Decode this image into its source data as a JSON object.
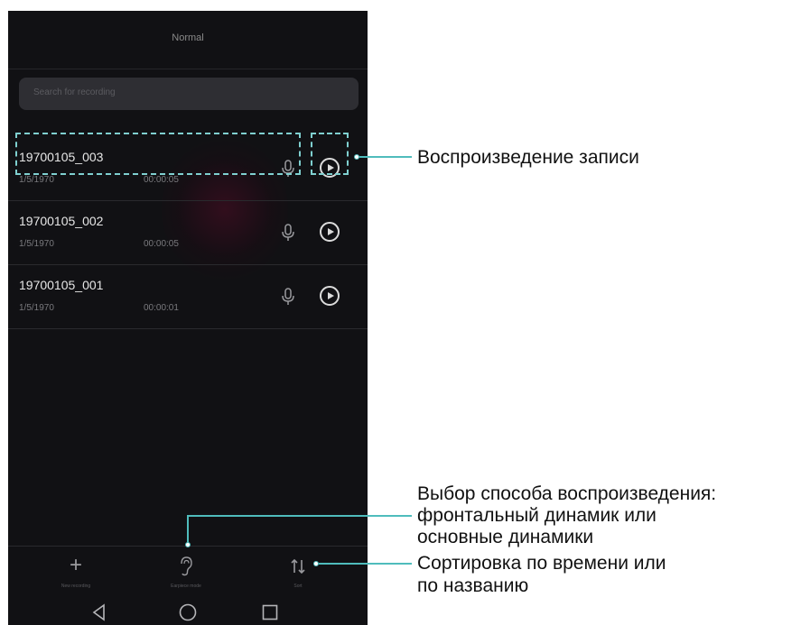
{
  "header": {
    "title": "Normal"
  },
  "search": {
    "placeholder": "Search for recording"
  },
  "recordings": [
    {
      "name": "19700105_003",
      "date": "1/5/1970",
      "duration": "00:00:05"
    },
    {
      "name": "19700105_002",
      "date": "1/5/1970",
      "duration": "00:00:05"
    },
    {
      "name": "19700105_001",
      "date": "1/5/1970",
      "duration": "00:00:01"
    }
  ],
  "toolbar": {
    "new_recording": "New recording",
    "earpiece_mode": "Earpiece mode",
    "sort": "Sort"
  },
  "annotations": {
    "play": "Воспроизведение записи",
    "mode_line1": "Выбор способа воспроизведения:",
    "mode_line2": "фронтальный динамик или",
    "mode_line3": "основные динамики",
    "sort_line1": "Сортировка по времени или",
    "sort_line2": "по названию"
  },
  "colors": {
    "background": "#111114",
    "callout": "#4fbcbc"
  }
}
